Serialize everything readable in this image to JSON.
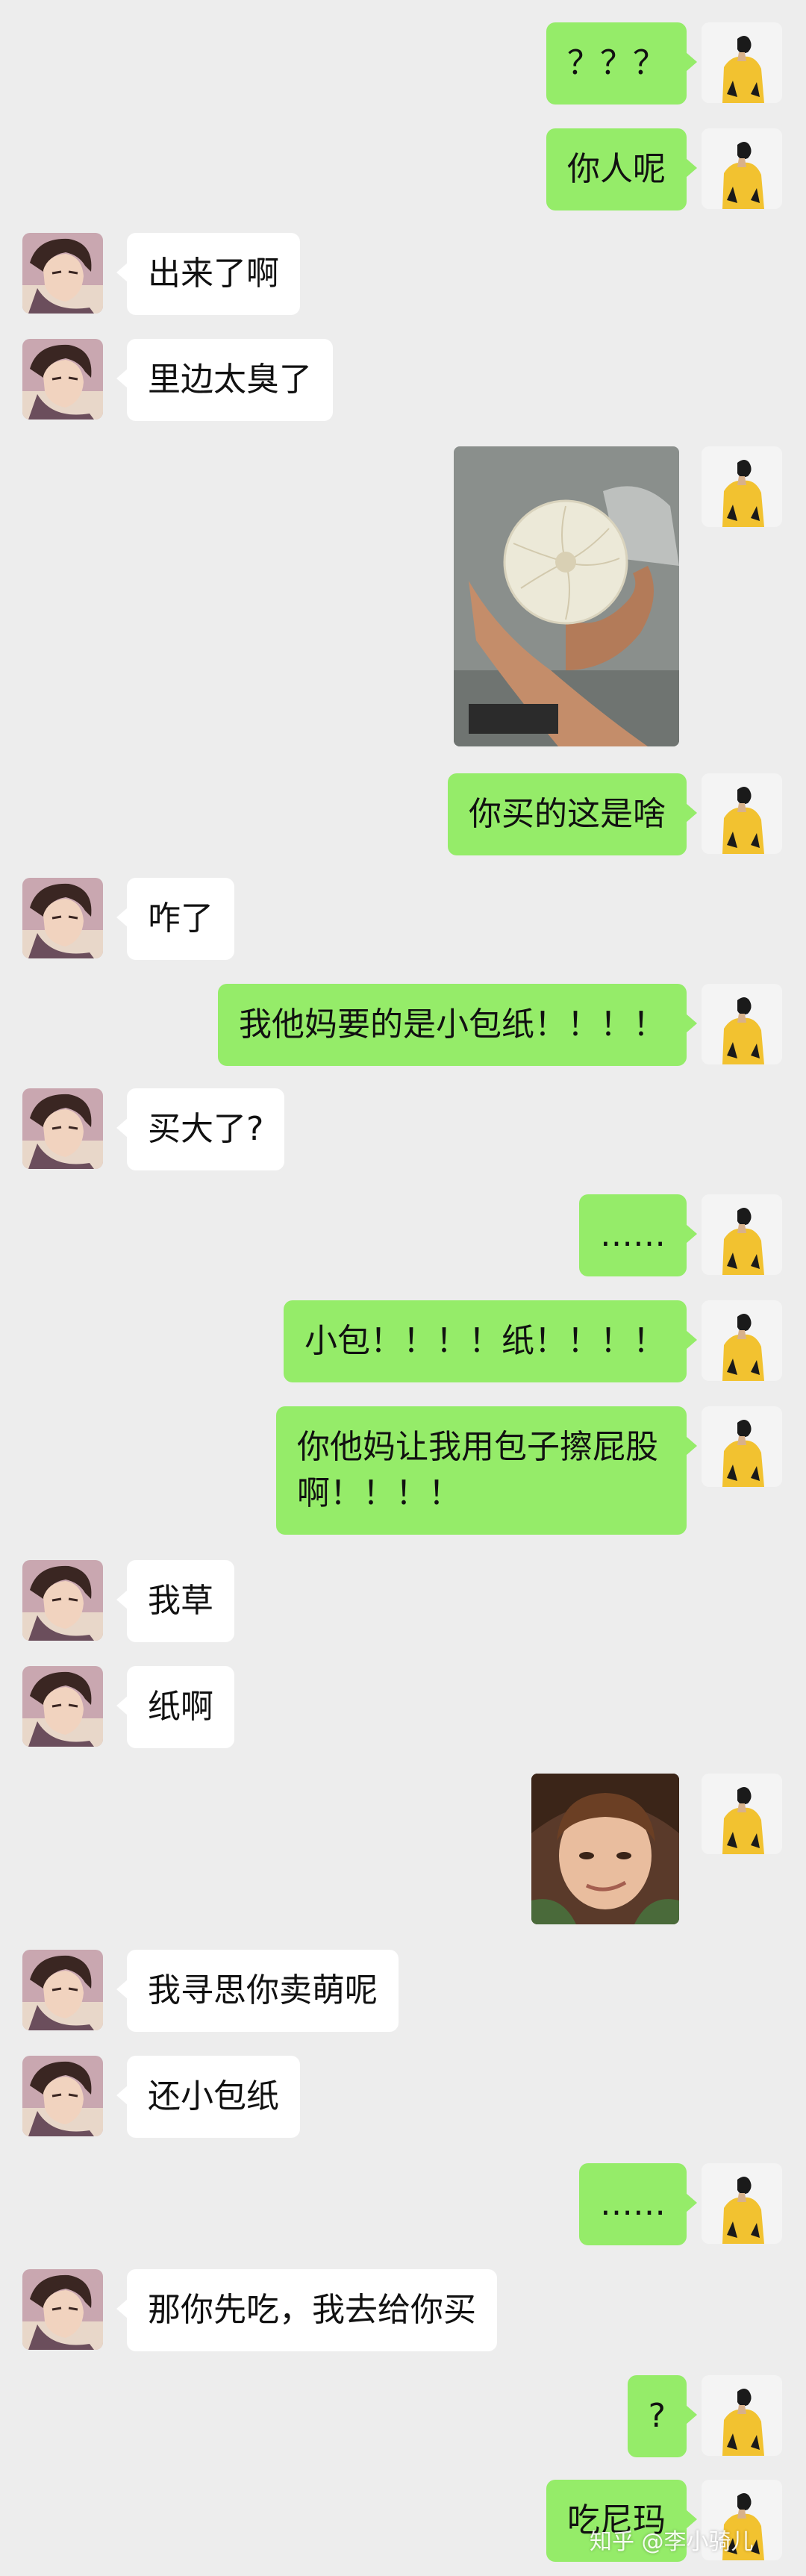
{
  "messages": [
    {
      "side": "right",
      "text": "？？？"
    },
    {
      "side": "right",
      "text": "你人呢"
    },
    {
      "side": "left",
      "text": "出来了啊"
    },
    {
      "side": "left",
      "text": "里边太臭了"
    },
    {
      "side": "right",
      "image": "steamed-bun-photo"
    },
    {
      "side": "right",
      "text": "你买的这是啥"
    },
    {
      "side": "left",
      "text": "咋了"
    },
    {
      "side": "right",
      "text": "我他妈要的是小包纸！！！！"
    },
    {
      "side": "left",
      "text": "买大了?"
    },
    {
      "side": "right",
      "text": "……"
    },
    {
      "side": "right",
      "text": "小包！！！！纸！！！！"
    },
    {
      "side": "right",
      "text": "你他妈让我用包子擦屁股啊！！！！"
    },
    {
      "side": "left",
      "text": "我草"
    },
    {
      "side": "left",
      "text": "纸啊"
    },
    {
      "side": "right",
      "image": "smirking-kid-meme"
    },
    {
      "side": "left",
      "text": "我寻思你卖萌呢"
    },
    {
      "side": "left",
      "text": "还小包纸"
    },
    {
      "side": "right",
      "text": "……"
    },
    {
      "side": "left",
      "text": "那你先吃，我去给你买"
    },
    {
      "side": "right",
      "text": "?"
    },
    {
      "side": "right",
      "text": "吃尼玛"
    }
  ],
  "watermark": "知乎 @李小骑儿",
  "colors": {
    "background": "#ededed",
    "outgoing_bubble": "#95ec69",
    "incoming_bubble": "#ffffff"
  }
}
